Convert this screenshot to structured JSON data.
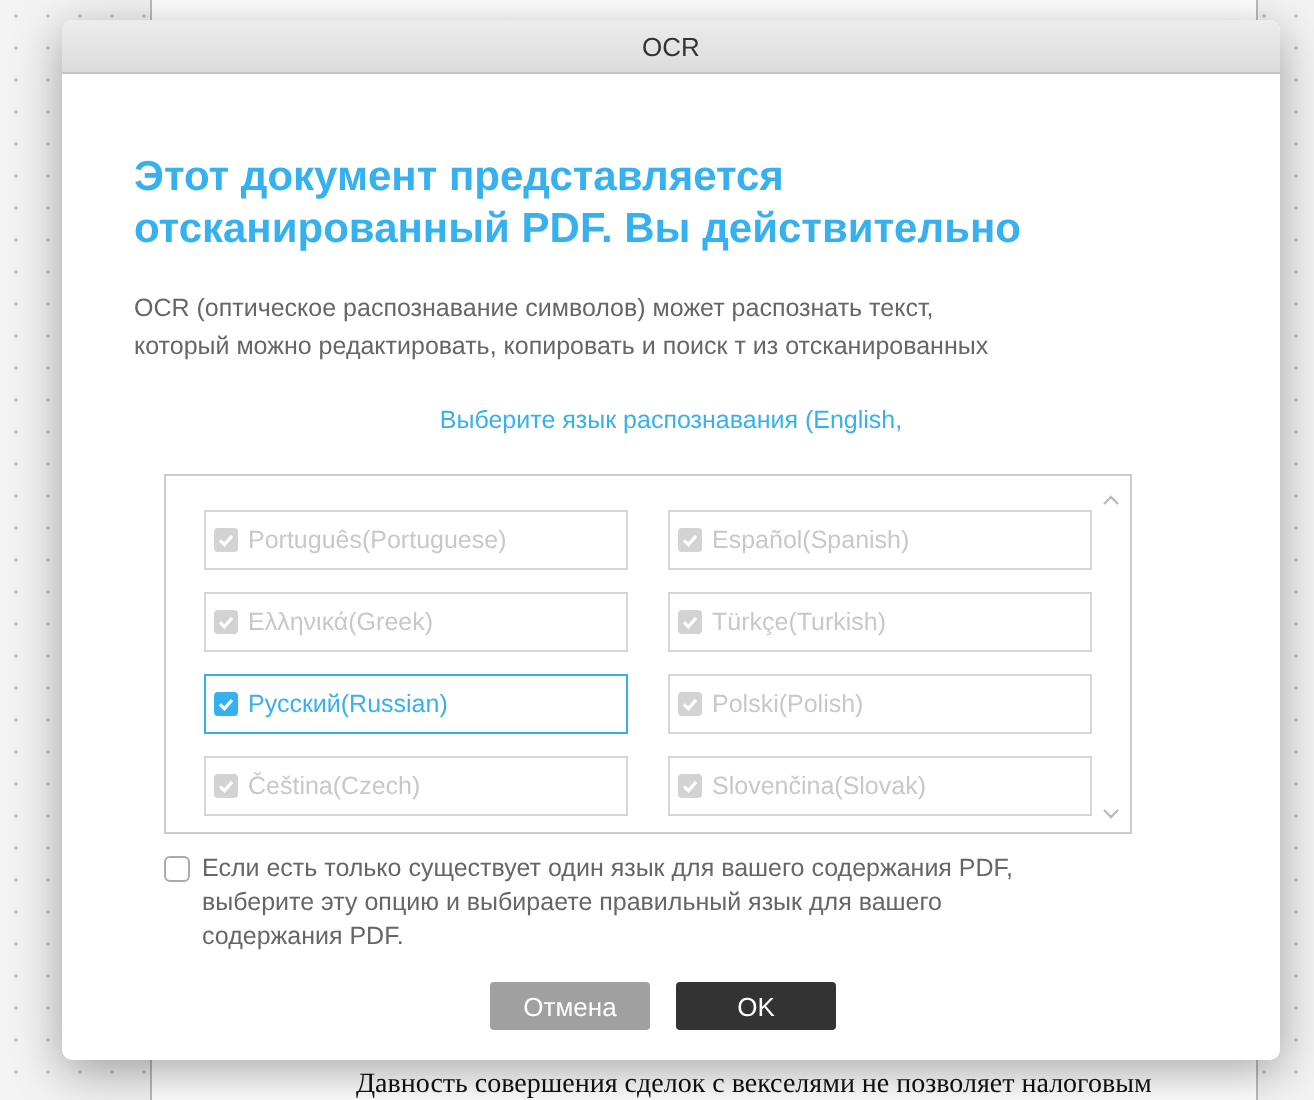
{
  "document": {
    "lines": [
      "Давность совершения сделок с векселями не позволяет налоговым"
    ]
  },
  "dialog": {
    "title": "OCR",
    "heading": "Этот документ представляется отсканированный PDF. Вы действительно",
    "description": "OCR (оптическое распознавание символов) может распознать текст, который можно редактировать, копировать и поиск т из отсканированных",
    "language_prompt": "Выберите язык распознавания (English,",
    "languages": [
      {
        "label": "Português(Portuguese)",
        "checked": true,
        "disabled": true
      },
      {
        "label": "Español(Spanish)",
        "checked": true,
        "disabled": true
      },
      {
        "label": "Ελληνικά(Greek)",
        "checked": true,
        "disabled": true
      },
      {
        "label": "Türkçe(Turkish)",
        "checked": true,
        "disabled": true
      },
      {
        "label": "Русский(Russian)",
        "checked": true,
        "disabled": false
      },
      {
        "label": "Polski(Polish)",
        "checked": true,
        "disabled": true
      },
      {
        "label": "Čeština(Czech)",
        "checked": true,
        "disabled": true
      },
      {
        "label": "Slovenčina(Slovak)",
        "checked": true,
        "disabled": true
      }
    ],
    "single_language_option": {
      "label": "Если есть только  существует один язык для вашего содержания PDF, выберите эту опцию и выбираете правильный язык для вашего содержания PDF.",
      "checked": false
    },
    "buttons": [
      {
        "label": "Отмена",
        "kind": "secondary"
      },
      {
        "label": "OK",
        "kind": "primary"
      }
    ]
  }
}
